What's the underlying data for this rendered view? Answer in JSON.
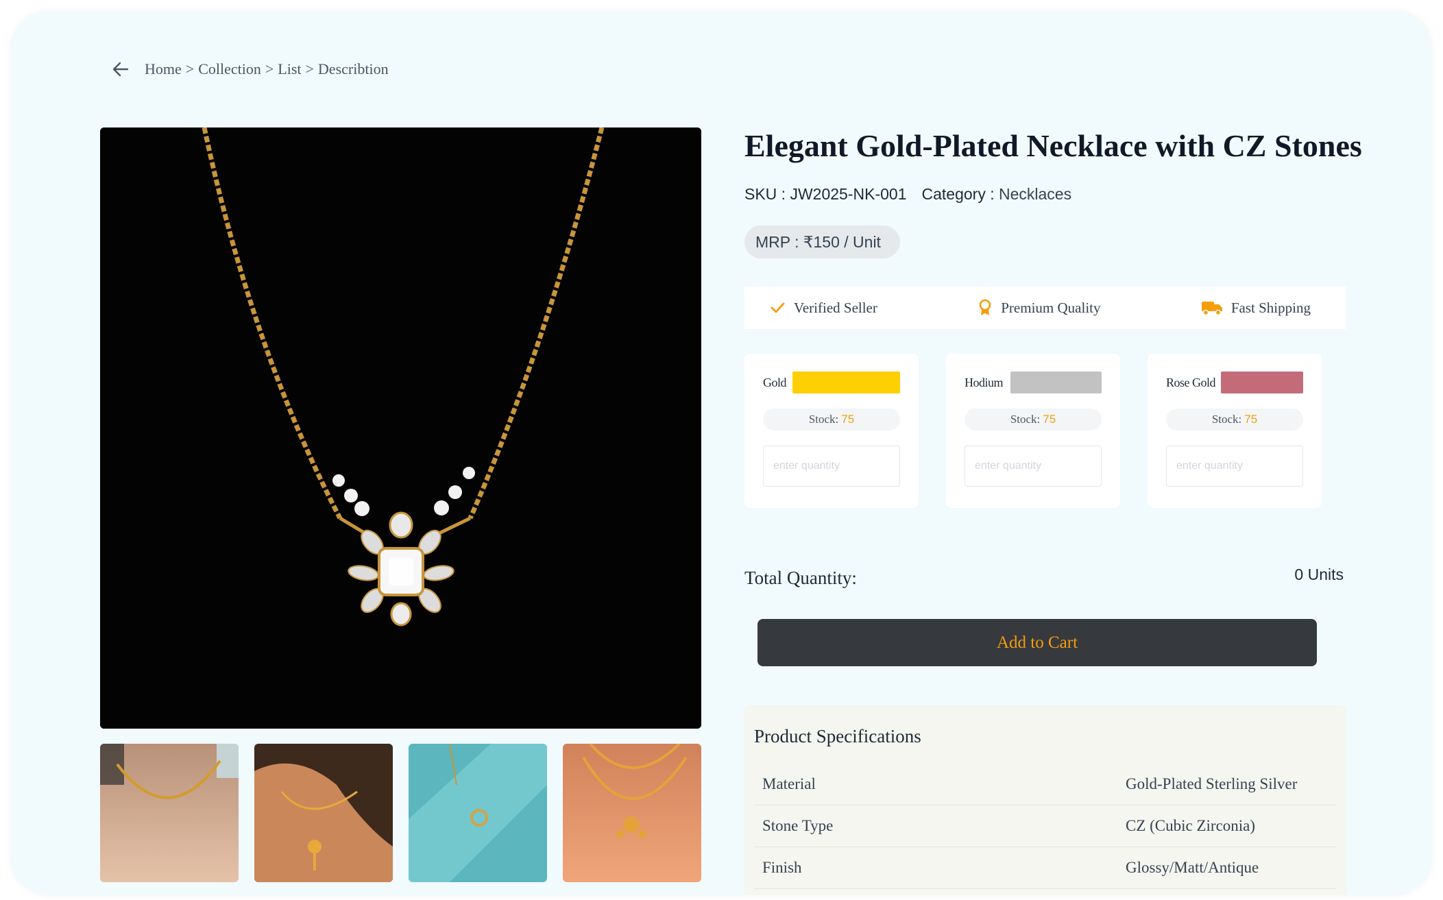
{
  "breadcrumb": {
    "items": [
      "Home",
      "Collection",
      "List",
      "Describtion"
    ],
    "separator": ">"
  },
  "product": {
    "title": "Elegant Gold-Plated Necklace with CZ Stones",
    "sku_label": "SKU : ",
    "sku": "JW2025-NK-001",
    "category_label": "Category : ",
    "category": "Necklaces",
    "mrp": "MRP : ₹150 / Unit"
  },
  "features": [
    {
      "label": "Verified Seller",
      "icon": "check-icon",
      "color": "#f59e0b"
    },
    {
      "label": "Premium Quality",
      "icon": "award-icon",
      "color": "#f59e0b"
    },
    {
      "label": "Fast Shipping",
      "icon": "truck-icon",
      "color": "#f59e0b"
    }
  ],
  "variants": [
    {
      "name": "Gold",
      "swatch": "#fecf02",
      "stock_label": "Stock:",
      "stock": "75",
      "placeholder": "enter quantity"
    },
    {
      "name": "Hodium",
      "swatch": "#c2c2c2",
      "stock_label": "Stock:",
      "stock": "75",
      "placeholder": "enter quantity"
    },
    {
      "name": "Rose Gold",
      "swatch": "#c36b78",
      "stock_label": "Stock:",
      "stock": "75",
      "placeholder": "enter quantity"
    }
  ],
  "total": {
    "label": "Total Quantity:",
    "value": "0 Units"
  },
  "add_to_cart": "Add to Cart",
  "specs": {
    "title": "Product Specifications",
    "rows": [
      {
        "key": "Material",
        "value": "Gold-Plated Sterling Silver"
      },
      {
        "key": "Stone Type",
        "value": "CZ (Cubic Zirconia)"
      },
      {
        "key": "Finish",
        "value": "Glossy/Matt/Antique"
      }
    ]
  },
  "colors": {
    "accent": "#f59e0b",
    "card_bg": "#f1fafd",
    "button_bg": "#36393e"
  }
}
